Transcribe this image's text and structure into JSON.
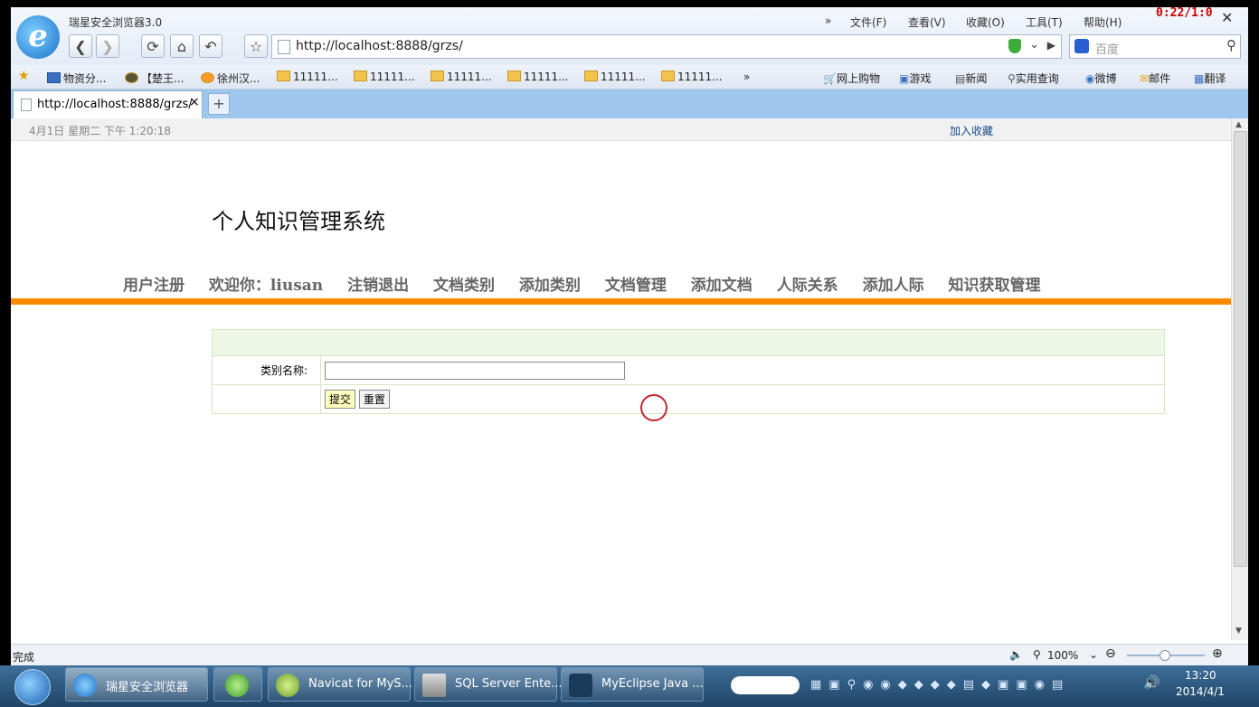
{
  "browser": {
    "title": "瑞星安全浏览器3.0",
    "menu": [
      "»",
      "文件(F)",
      "查看(V)",
      "收藏(O)",
      "工具(T)",
      "帮助(H)"
    ],
    "url": "http://localhost:8888/grzs/",
    "search_placeholder": "百度",
    "recording_timer": "0:22/1:0"
  },
  "favorites": {
    "left": [
      "物资分...",
      "【楚王...",
      "徐州汉...",
      "11111...",
      "11111...",
      "11111...",
      "11111...",
      "11111...",
      "11111..."
    ],
    "more": "»",
    "right": [
      "网上购物",
      "游戏",
      "新闻",
      "实用查询",
      "微博",
      "邮件",
      "翻译"
    ]
  },
  "tab": {
    "title": "http://localhost:8888/grzs/",
    "close": "×",
    "new": "+"
  },
  "page": {
    "datetime": "4月1日 星期二 下午 1:20:18",
    "bookmark_link": "加入收藏",
    "site_title": "个人知识管理系统",
    "nav": [
      "用户注册",
      "欢迎你：liusan",
      "注销退出",
      "文档类别",
      "添加类别",
      "文档管理",
      "添加文档",
      "人际关系",
      "添加人际",
      "知识获取管理"
    ],
    "form": {
      "label": "类别名称:",
      "value": "",
      "submit": "提交",
      "reset": "重置"
    }
  },
  "statusbar": {
    "text": "完成",
    "zoom": "100%"
  },
  "taskbar": {
    "items": [
      "瑞星安全浏览器",
      "Navicat for MyS...",
      "SQL Server Ente...",
      "MyEclipse Java ..."
    ],
    "time": "13:20",
    "date": "2014/4/1"
  },
  "colors": {
    "accent_orange": "#ff8a00",
    "form_header": "#eef6e6",
    "taskbar": "#2d5a84"
  }
}
